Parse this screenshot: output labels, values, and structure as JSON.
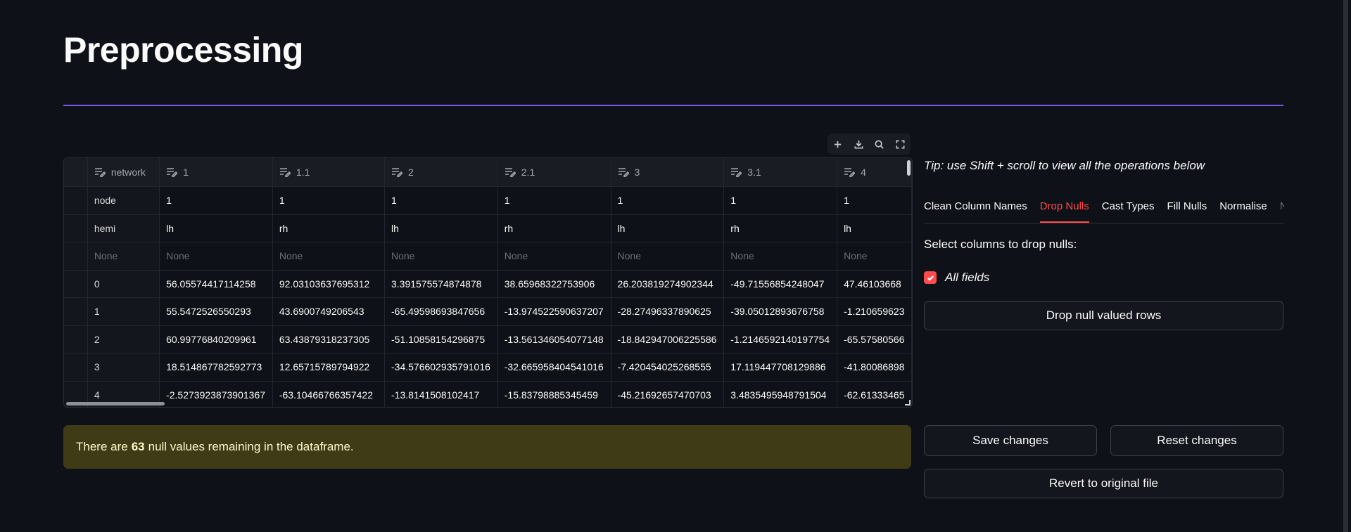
{
  "page": {
    "title": "Preprocessing"
  },
  "toolbar": {
    "icons": [
      "add-icon",
      "download-icon",
      "search-icon",
      "fullscreen-icon"
    ]
  },
  "table": {
    "columns": [
      "network",
      "1",
      "1.1",
      "2",
      "2.1",
      "3",
      "3.1",
      "4"
    ],
    "rows": [
      [
        "node",
        "1",
        "1",
        "1",
        "1",
        "1",
        "1",
        "1"
      ],
      [
        "hemi",
        "lh",
        "rh",
        "lh",
        "rh",
        "lh",
        "rh",
        "lh"
      ],
      [
        "None",
        "None",
        "None",
        "None",
        "None",
        "None",
        "None",
        "None"
      ],
      [
        "0",
        "56.05574417114258",
        "92.03103637695312",
        "3.391575574874878",
        "38.65968322753906",
        "26.203819274902344",
        "-49.71556854248047",
        "47.46103668"
      ],
      [
        "1",
        "55.5472526550293",
        "43.6900749206543",
        "-65.49598693847656",
        "-13.974522590637207",
        "-28.27496337890625",
        "-39.05012893676758",
        "-1.210659623"
      ],
      [
        "2",
        "60.99776840209961",
        "63.43879318237305",
        "-51.10858154296875",
        "-13.561346054077148",
        "-18.842947006225586",
        "-1.2146592140197754",
        "-65.57580566"
      ],
      [
        "3",
        "18.514867782592773",
        "12.65715789794922",
        "-34.576602935791016",
        "-32.665958404541016",
        "-7.420454025268555",
        "17.119447708129886",
        "-41.80086898"
      ],
      [
        "4",
        "-2.5273923873901367",
        "-63.10466766357422",
        "-13.8141508102417",
        "-15.83798885345459",
        "-45.21692657470703",
        "3.4835495948791504",
        "-62.61333465"
      ]
    ]
  },
  "alert": {
    "prefix": "There are",
    "count": "63",
    "suffix": "null values remaining in the dataframe."
  },
  "panel": {
    "tip": "Tip: use Shift + scroll to view all the operations below",
    "tabs": [
      "Clean Column Names",
      "Drop Nulls",
      "Cast Types",
      "Fill Nulls",
      "Normalise",
      "No"
    ],
    "active_tab": "Drop Nulls",
    "select_label": "Select columns to drop nulls:",
    "checkbox_label": "All fields",
    "checkbox_checked": true,
    "drop_button": "Drop null valued rows",
    "save_button": "Save changes",
    "reset_button": "Reset changes",
    "revert_button": "Revert to original file"
  },
  "colors": {
    "accent": "#ff4b4b",
    "divider": "#7e57f0",
    "alert_bg": "#3e3b16",
    "background": "#0e1117"
  }
}
